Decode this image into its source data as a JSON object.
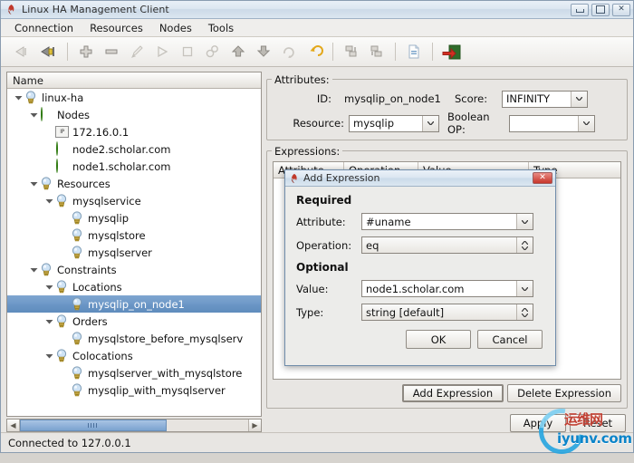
{
  "window": {
    "title": "Linux HA Management Client",
    "icon": "app-icon",
    "controls": {
      "minimize": "Minimize",
      "maximize": "Maximize",
      "close": "Close"
    }
  },
  "menubar": {
    "items": [
      {
        "label": "Connection",
        "name": "menu-connection"
      },
      {
        "label": "Resources",
        "name": "menu-resources"
      },
      {
        "label": "Nodes",
        "name": "menu-nodes"
      },
      {
        "label": "Tools",
        "name": "menu-tools"
      }
    ]
  },
  "toolbar": {
    "buttons": [
      {
        "name": "disconnect-icon",
        "title": "Disconnect",
        "enabled": false
      },
      {
        "name": "connect-icon",
        "title": "Connect",
        "enabled": true
      },
      {
        "sep": true
      },
      {
        "name": "add-icon",
        "title": "Add",
        "enabled": true
      },
      {
        "name": "remove-icon",
        "title": "Remove",
        "enabled": true
      },
      {
        "name": "cleanup-brush-icon",
        "title": "Cleanup",
        "enabled": false
      },
      {
        "name": "start-play-icon",
        "title": "Start",
        "enabled": false
      },
      {
        "name": "stop-square-icon",
        "title": "Stop",
        "enabled": false
      },
      {
        "name": "manage-gears-icon",
        "title": "Manage",
        "enabled": false
      },
      {
        "name": "move-up-icon",
        "title": "Move Up",
        "enabled": true
      },
      {
        "name": "move-down-icon",
        "title": "Move Down",
        "enabled": true
      },
      {
        "name": "refresh-icon",
        "title": "Refresh",
        "enabled": false
      },
      {
        "name": "undo-icon",
        "title": "Undo",
        "enabled": true
      },
      {
        "sep": true
      },
      {
        "name": "migrate-icon",
        "title": "Migrate",
        "enabled": false
      },
      {
        "name": "unmigrate-icon",
        "title": "Unmigrate",
        "enabled": false
      },
      {
        "sep": true
      },
      {
        "name": "document-icon",
        "title": "CIB",
        "enabled": true
      },
      {
        "sep": true
      },
      {
        "name": "exit-icon",
        "title": "Exit",
        "enabled": true
      }
    ]
  },
  "tree": {
    "header": "Name",
    "nodes": [
      {
        "label": "linux-ha",
        "depth": 0,
        "icon": "bulb-icon",
        "twist": "down",
        "selected": false
      },
      {
        "label": "Nodes",
        "depth": 1,
        "icon": "green-dot-icon",
        "twist": "down",
        "selected": false
      },
      {
        "label": "172.16.0.1",
        "depth": 2,
        "icon": "ip-icon",
        "twist": "none",
        "selected": false
      },
      {
        "label": "node2.scholar.com",
        "depth": 2,
        "icon": "green-dot-icon",
        "twist": "none",
        "selected": false
      },
      {
        "label": "node1.scholar.com",
        "depth": 2,
        "icon": "green-dot-icon",
        "twist": "none",
        "selected": false
      },
      {
        "label": "Resources",
        "depth": 1,
        "icon": "bulb-icon",
        "twist": "down",
        "selected": false
      },
      {
        "label": "mysqlservice",
        "depth": 2,
        "icon": "bulb-icon",
        "twist": "down",
        "selected": false
      },
      {
        "label": "mysqlip",
        "depth": 3,
        "icon": "bulb-icon",
        "twist": "none",
        "selected": false
      },
      {
        "label": "mysqlstore",
        "depth": 3,
        "icon": "bulb-icon",
        "twist": "none",
        "selected": false
      },
      {
        "label": "mysqlserver",
        "depth": 3,
        "icon": "bulb-icon",
        "twist": "none",
        "selected": false
      },
      {
        "label": "Constraints",
        "depth": 1,
        "icon": "bulb-icon",
        "twist": "down",
        "selected": false
      },
      {
        "label": "Locations",
        "depth": 2,
        "icon": "bulb-icon",
        "twist": "down",
        "selected": false
      },
      {
        "label": "mysqlip_on_node1",
        "depth": 3,
        "icon": "bulb-icon",
        "twist": "none",
        "selected": true
      },
      {
        "label": "Orders",
        "depth": 2,
        "icon": "bulb-icon",
        "twist": "down",
        "selected": false
      },
      {
        "label": "mysqlstore_before_mysqlserv",
        "depth": 3,
        "icon": "bulb-icon",
        "twist": "none",
        "selected": false
      },
      {
        "label": "Colocations",
        "depth": 2,
        "icon": "bulb-icon",
        "twist": "down",
        "selected": false
      },
      {
        "label": "mysqlserver_with_mysqlstore",
        "depth": 3,
        "icon": "bulb-icon",
        "twist": "none",
        "selected": false
      },
      {
        "label": "mysqlip_with_mysqlserver",
        "depth": 3,
        "icon": "bulb-icon",
        "twist": "none",
        "selected": false
      }
    ]
  },
  "attributes": {
    "legend": "Attributes:",
    "id_label": "ID:",
    "id_value": "mysqlip_on_node1",
    "score_label": "Score:",
    "score_value": "INFINITY",
    "resource_label": "Resource:",
    "resource_value": "mysqlip",
    "boolean_op_label": "Boolean OP:",
    "boolean_op_value": ""
  },
  "expressions": {
    "legend": "Expressions:",
    "columns": [
      "Attribute",
      "Operation",
      "Value",
      "Type"
    ],
    "rows": [],
    "add_button": "Add Expression",
    "delete_button": "Delete Expression"
  },
  "form_buttons": {
    "apply": "Apply",
    "reset": "Reset"
  },
  "statusbar": {
    "text": "Connected to 127.0.0.1"
  },
  "dialog": {
    "title": "Add Expression",
    "icon": "app-icon",
    "close_label": "✕",
    "required_heading": "Required",
    "optional_heading": "Optional",
    "fields": [
      {
        "label": "Attribute:",
        "value": "#uname",
        "control": "combobox",
        "name": "attribute-combobox"
      },
      {
        "label": "Operation:",
        "value": "eq",
        "control": "spinner",
        "name": "operation-spinner"
      },
      {
        "label": "Value:",
        "value": "node1.scholar.com",
        "control": "combobox",
        "name": "value-combobox"
      },
      {
        "label": "Type:",
        "value": "string     [default]",
        "control": "spinner",
        "name": "type-spinner"
      }
    ],
    "ok": "OK",
    "cancel": "Cancel"
  },
  "watermark": {
    "cn": "运维网",
    "url": "iyunv.com"
  },
  "colors": {
    "selection": "#6b96c6",
    "title_bar": "#dde7f1",
    "window_bg": "#e8e6e3",
    "node_green": "#4fae1e",
    "close_red": "#c6352b",
    "watermark_blue": "#0b84c9",
    "watermark_red": "#c0392b"
  }
}
